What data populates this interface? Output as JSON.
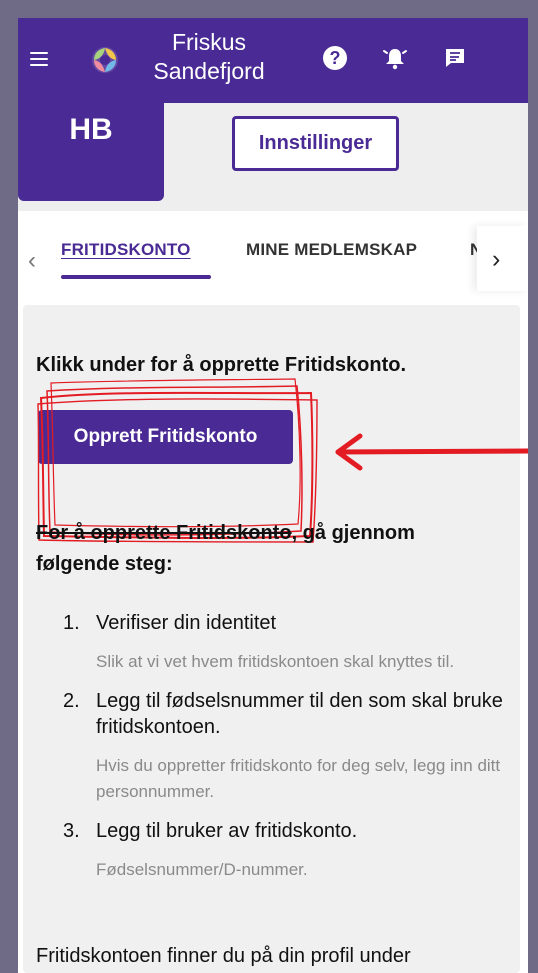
{
  "header": {
    "app_name_line1": "Friskus",
    "app_name_line2": "Sandefjord",
    "help_icon": "?",
    "icons": [
      "menu-icon",
      "logo-icon",
      "help-icon",
      "bell-icon",
      "chat-icon"
    ]
  },
  "profile": {
    "initials": "HB",
    "settings_label": "Innstillinger"
  },
  "tabs": [
    {
      "label": "FRITIDSKONTO",
      "active": true
    },
    {
      "label": "MINE MEDLEMSKAP",
      "active": false
    },
    {
      "label": "N",
      "active": false
    }
  ],
  "main": {
    "intro": "Klikk under for å opprette Fritidskonto.",
    "create_button_label": "Opprett Fritidskonto",
    "steps_title_strike": "For å opprette Fritidskonto",
    "steps_title_rest": ", gå gjennom følgende steg:",
    "steps": [
      {
        "number": "1.",
        "title": "Verifiser din identitet",
        "description": "Slik at vi vet hvem fritidskontoen skal knyttes til."
      },
      {
        "number": "2.",
        "title": "Legg til fødselsnummer til den som skal bruke fritidskontoen.",
        "description": "Hvis du oppretter fritidskonto for deg selv, legg inn ditt personnummer."
      },
      {
        "number": "3.",
        "title": "Legg til bruker av fritidskonto.",
        "description": "Fødselsnummer/D-nummer."
      }
    ],
    "footer": "Fritidskontoen finner du på din profil under"
  },
  "colors": {
    "brand_purple": "#4a2a94",
    "annotation_red": "#e31b23",
    "background": "#f0f0f0"
  }
}
